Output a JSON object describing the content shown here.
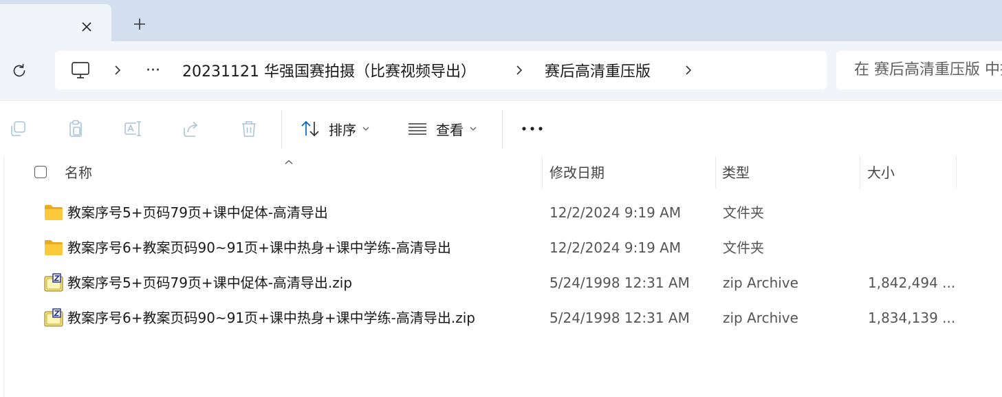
{
  "window": {
    "tab": {
      "close_icon": "close-icon",
      "new_tab_icon": "plus-icon"
    }
  },
  "address": {
    "refresh_icon": "refresh-icon",
    "computer_icon": "computer-icon",
    "overflow": "···",
    "crumbs": [
      "20231121 华强国赛拍摄（比赛视频导出）",
      "赛后高清重压版"
    ],
    "search_placeholder": "在 赛后高清重压版 中搜索"
  },
  "toolbar": {
    "sort_label": "排序",
    "view_label": "查看",
    "more_label": "···",
    "disabled_icons": [
      "copy-icon",
      "paste-icon",
      "rename-icon",
      "share-icon",
      "delete-icon"
    ],
    "disabled_color": "#a8c3df",
    "accent_color": "#0067c0"
  },
  "list": {
    "columns": {
      "name": "名称",
      "date": "修改日期",
      "type": "类型",
      "size": "大小"
    },
    "sort_column": "name",
    "rows": [
      {
        "name": "教案序号5+页码79页+课中促体-高清导出",
        "date": "12/2/2024 9:19 AM",
        "type": "文件夹",
        "size": "",
        "icon": "folder-icon"
      },
      {
        "name": "教案序号6+教案页码90~91页+课中热身+课中学练-高清导出",
        "date": "12/2/2024 9:19 AM",
        "type": "文件夹",
        "size": "",
        "icon": "folder-icon"
      },
      {
        "name": "教案序号5+页码79页+课中促体-高清导出.zip",
        "date": "5/24/1998 12:31 AM",
        "type": "zip Archive",
        "size": "1,842,494 ...",
        "icon": "zip-archive-icon"
      },
      {
        "name": "教案序号6+教案页码90~91页+课中热身+课中学练-高清导出.zip",
        "date": "5/24/1998 12:31 AM",
        "type": "zip Archive",
        "size": "1,834,139 ...",
        "icon": "zip-archive-icon"
      }
    ]
  }
}
